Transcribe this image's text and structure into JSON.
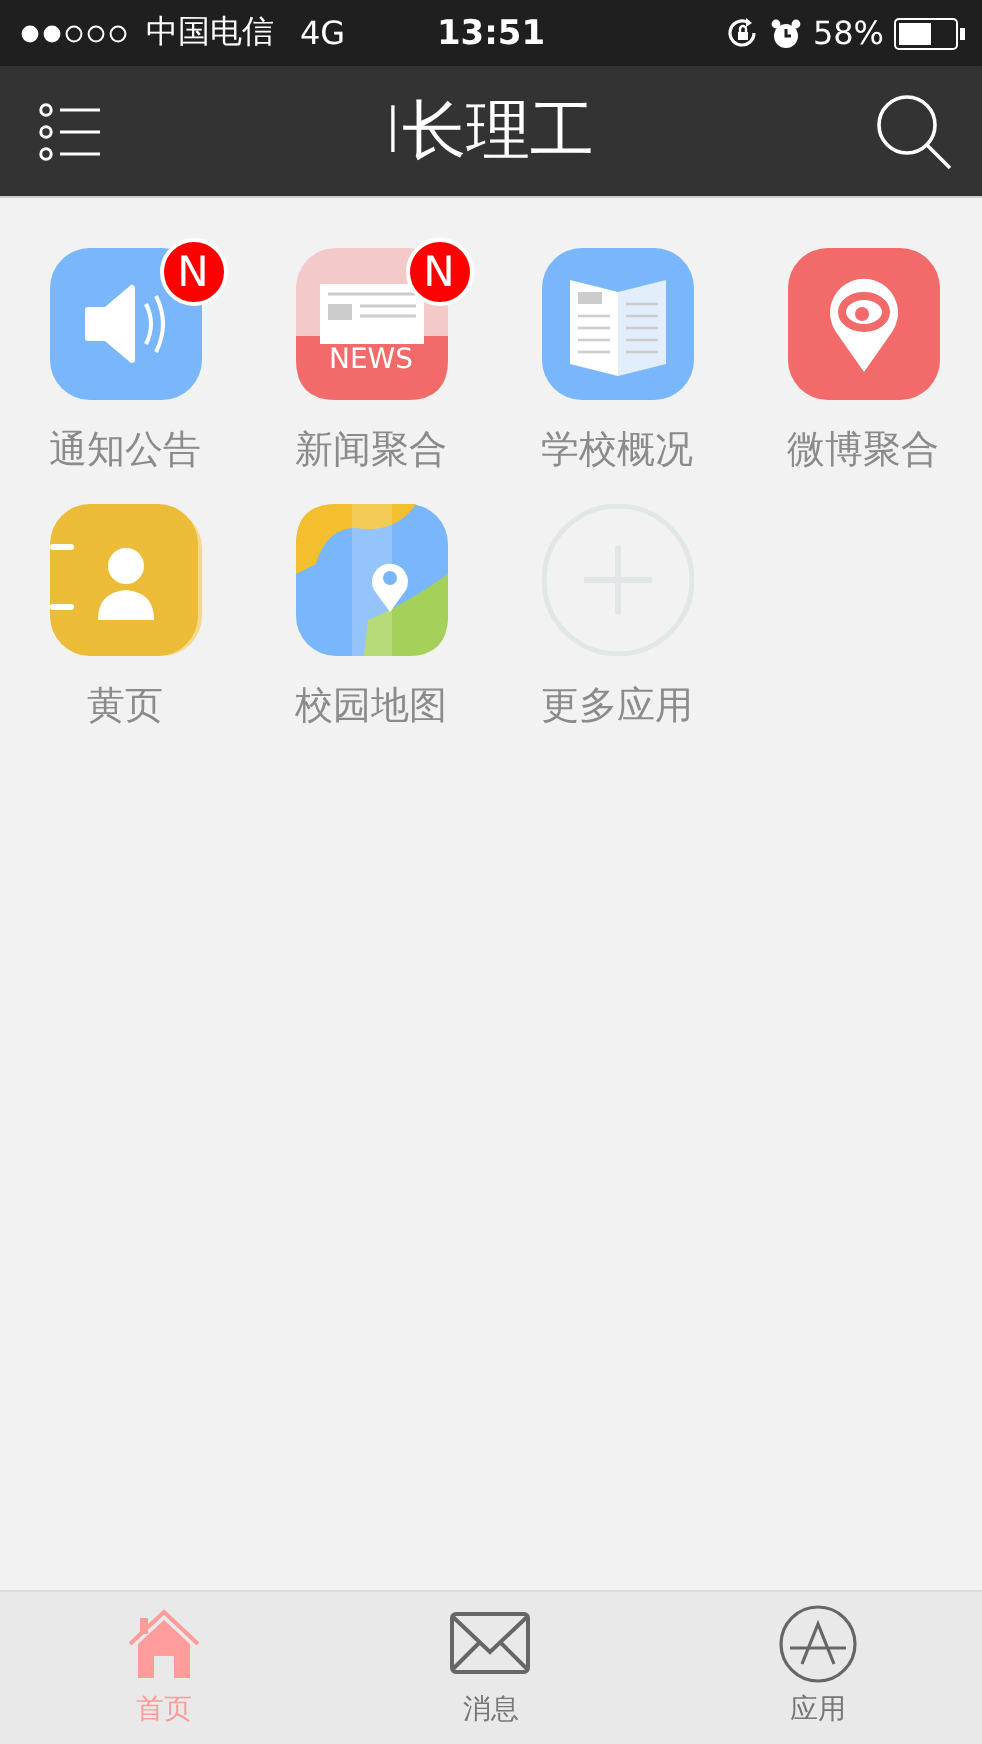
{
  "status_bar": {
    "carrier": "中国电信",
    "network": "4G",
    "time": "13:51",
    "battery": "58%"
  },
  "nav_bar": {
    "title": "I长理工"
  },
  "apps": [
    {
      "label": "通知公告",
      "kind": "speaker",
      "badge": "N"
    },
    {
      "label": "新闻聚合",
      "kind": "news",
      "badge": "N",
      "icon_text": "NEWS"
    },
    {
      "label": "学校概况",
      "kind": "book"
    },
    {
      "label": "微博聚合",
      "kind": "weibo"
    },
    {
      "label": "黄页",
      "kind": "contacts"
    },
    {
      "label": "校园地图",
      "kind": "map"
    },
    {
      "label": "更多应用",
      "kind": "add"
    }
  ],
  "tab_bar": [
    {
      "label": "首页",
      "kind": "home",
      "selected": true
    },
    {
      "label": "消息",
      "kind": "mail",
      "selected": false
    },
    {
      "label": "应用",
      "kind": "store",
      "selected": false
    }
  ]
}
